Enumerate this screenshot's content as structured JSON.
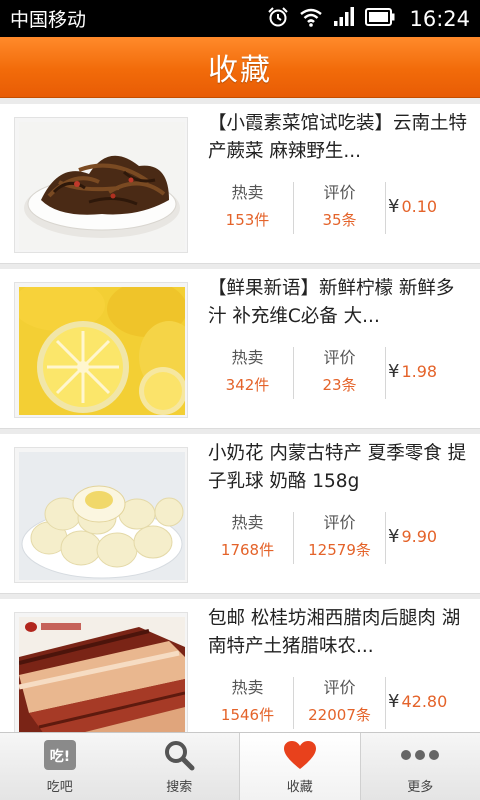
{
  "status_bar": {
    "carrier": "中国移动",
    "time": "16:24",
    "icons": [
      "alarm-icon",
      "wifi-icon",
      "signal-icon",
      "battery-icon"
    ]
  },
  "header": {
    "title": "收藏"
  },
  "favorites": {
    "sold_label": "热卖",
    "review_label": "评价",
    "currency": "¥",
    "items": [
      {
        "title": "【小霞素菜馆试吃装】云南土特产蕨菜 麻辣野生...",
        "sold": "153件",
        "reviews": "35条",
        "price": "0.10"
      },
      {
        "title": "【鲜果新语】新鲜柠檬 新鲜多汁 补充维C必备 大...",
        "sold": "342件",
        "reviews": "23条",
        "price": "1.98"
      },
      {
        "title": "小奶花 内蒙古特产 夏季零食 提子乳球 奶酪 158g",
        "sold": "1768件",
        "reviews": "12579条",
        "price": "9.90"
      },
      {
        "title": "包邮 松桂坊湘西腊肉后腿肉 湖南特产土猪腊味农...",
        "sold": "1546件",
        "reviews": "22007条",
        "price": "42.80"
      }
    ]
  },
  "tab_bar": {
    "tabs": [
      {
        "label": "吃吧",
        "icon": "chiba-logo-icon",
        "icon_text": "吃!"
      },
      {
        "label": "搜索",
        "icon": "search-icon"
      },
      {
        "label": "收藏",
        "icon": "heart-icon",
        "active": true
      },
      {
        "label": "更多",
        "icon": "more-dots-icon"
      }
    ]
  },
  "colors": {
    "accent": "#f26b0a",
    "price": "#e4632a"
  }
}
